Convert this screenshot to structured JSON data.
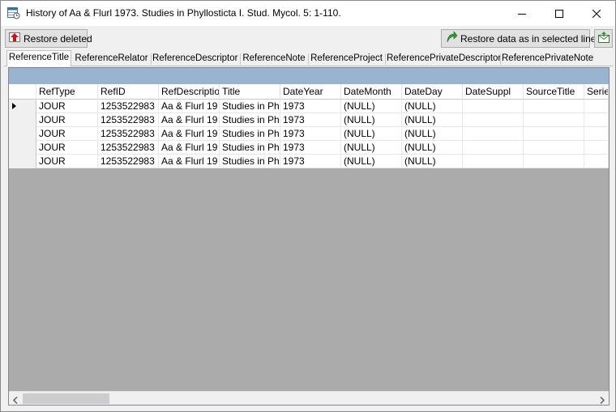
{
  "window": {
    "title": "History of Aa & Flurl 1973. Studies in Phyllosticta I. Stud. Mycol. 5: 1-110."
  },
  "toolbar": {
    "restore_deleted_label": "Restore deleted",
    "restore_data_label": "Restore data as in selected line"
  },
  "tabs": [
    {
      "label": "ReferenceTitle",
      "active": true
    },
    {
      "label": "ReferenceRelator",
      "active": false
    },
    {
      "label": "ReferenceDescriptor",
      "active": false
    },
    {
      "label": "ReferenceNote",
      "active": false
    },
    {
      "label": "ReferenceProject",
      "active": false
    },
    {
      "label": "ReferencePrivateDescriptor",
      "active": false
    },
    {
      "label": "ReferencePrivateNote",
      "active": false
    }
  ],
  "grid": {
    "columns": [
      "RefType",
      "RefID",
      "RefDescriptio",
      "Title",
      "DateYear",
      "DateMonth",
      "DateDay",
      "DateSuppl",
      "SourceTitle",
      "Series"
    ],
    "rows": [
      {
        "selected": true,
        "cells": [
          "JOUR",
          "1253522983",
          "Aa & Flurl 19",
          "Studies in Ph",
          "1973",
          "(NULL)",
          "(NULL)",
          "",
          "",
          ""
        ]
      },
      {
        "selected": false,
        "cells": [
          "JOUR",
          "1253522983",
          "Aa & Flurl 19",
          "Studies in Ph",
          "1973",
          "(NULL)",
          "(NULL)",
          "",
          "",
          ""
        ]
      },
      {
        "selected": false,
        "cells": [
          "JOUR",
          "1253522983",
          "Aa & Flurl 19",
          "Studies in Ph",
          "1973",
          "(NULL)",
          "(NULL)",
          "",
          "",
          ""
        ]
      },
      {
        "selected": false,
        "cells": [
          "JOUR",
          "1253522983",
          "Aa & Flurl 19",
          "Studies in Ph",
          "1973",
          "(NULL)",
          "(NULL)",
          "",
          "",
          ""
        ]
      },
      {
        "selected": false,
        "cells": [
          "JOUR",
          "1253522983",
          "Aa & Flurl 19",
          "Studies in Ph",
          "1973",
          "(NULL)",
          "(NULL)",
          "",
          "",
          ""
        ]
      }
    ]
  },
  "icons": {
    "app": "history-table-icon",
    "restore_deleted": "restore-red-arrow-icon",
    "restore_data": "restore-green-arrow-icon",
    "mail": "mail-icon"
  },
  "colors": {
    "caption_bar": "#99b4d1",
    "grid_background": "#ababab"
  }
}
